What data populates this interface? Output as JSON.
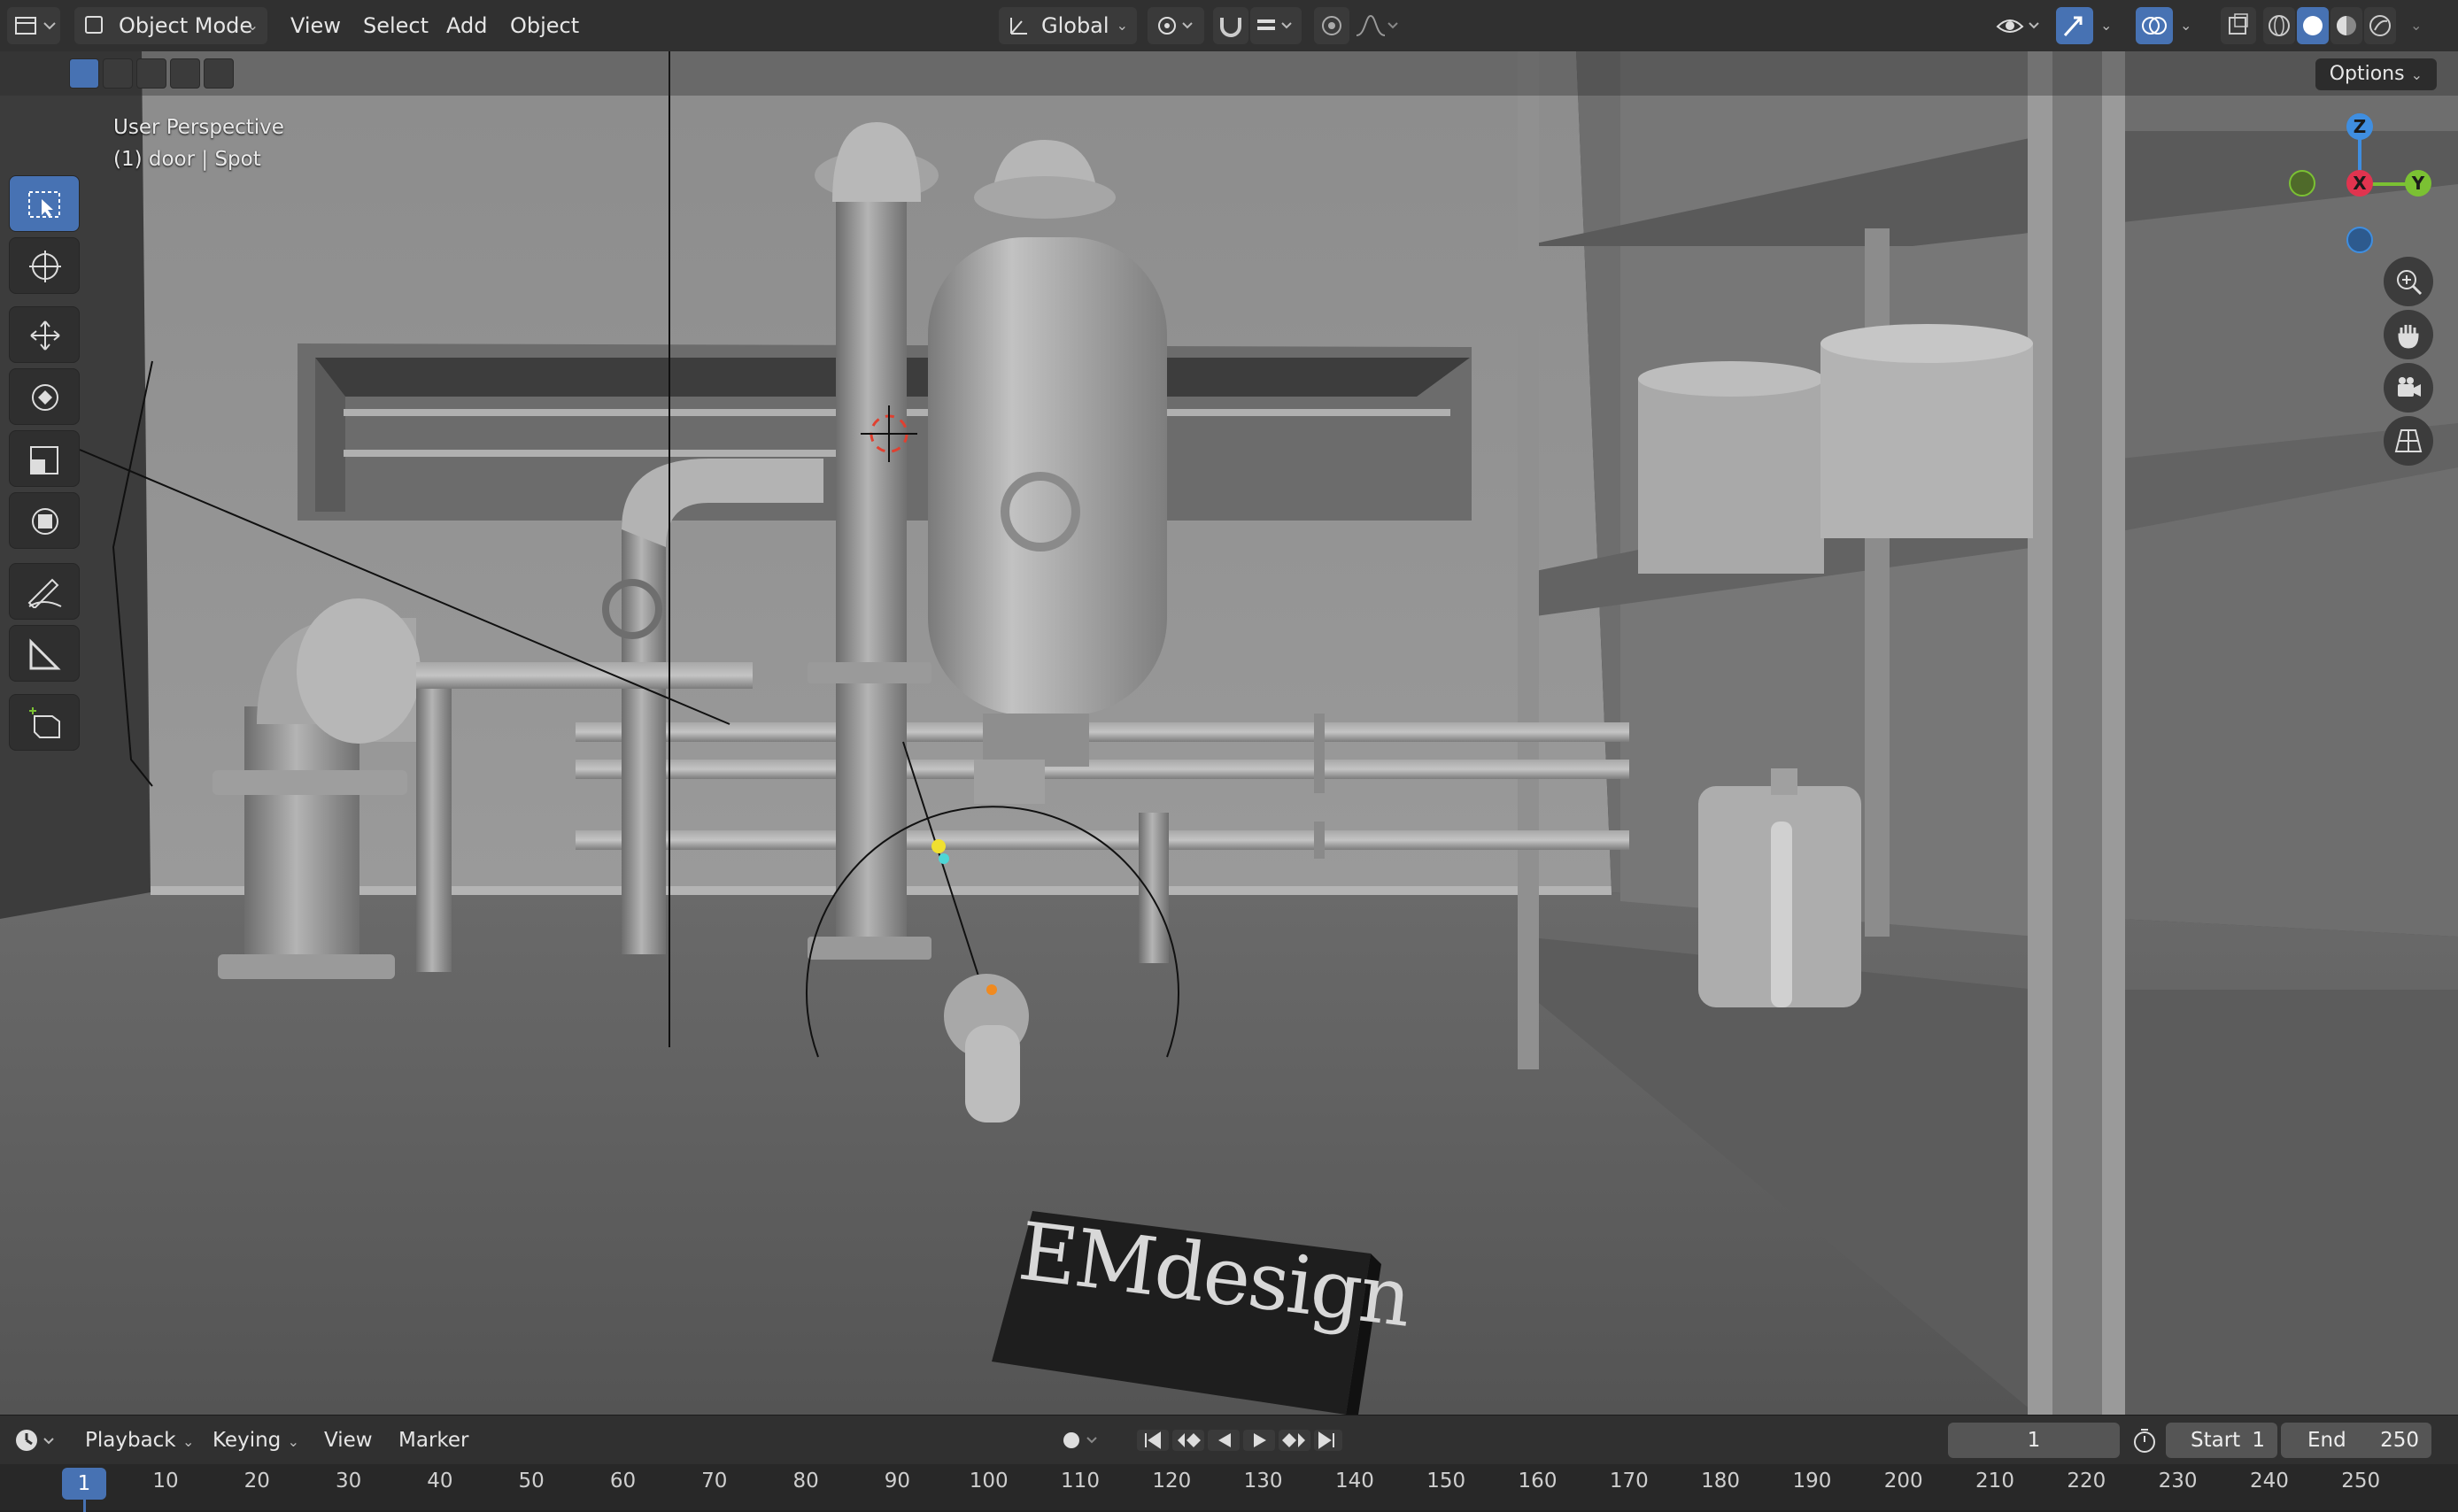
{
  "header": {
    "mode": "Object Mode",
    "menus": [
      "View",
      "Select",
      "Add",
      "Object"
    ],
    "transform_orientation": "Global",
    "options_label": "Options"
  },
  "viewport": {
    "perspective_label": "User Perspective",
    "object_label": "(1) door | Spot",
    "watermark": "EMdesign",
    "gizmo": {
      "z": "Z",
      "x": "X",
      "y": "Y"
    },
    "colors": {
      "background": "#4a4a4a",
      "wall": "#8a8a8a",
      "floor": "#5f5f5f",
      "accent": "#4772b3",
      "axis_x": "#e0344f",
      "axis_y": "#7bc133",
      "axis_z": "#3f8ee0"
    }
  },
  "tools": [
    "select-box-icon",
    "cursor-icon",
    "move-icon",
    "rotate-icon",
    "scale-icon",
    "transform-icon",
    "annotate-icon",
    "measure-icon",
    "add-cube-icon"
  ],
  "timeline": {
    "menus": [
      "Playback",
      "Keying",
      "View",
      "Marker"
    ],
    "current_frame": "1",
    "start_label": "Start",
    "start_value": "1",
    "end_label": "End",
    "end_value": "250",
    "ruler_ticks": [
      "10",
      "20",
      "30",
      "40",
      "50",
      "60",
      "70",
      "80",
      "90",
      "100",
      "110",
      "120",
      "130",
      "140",
      "150",
      "160",
      "170",
      "180",
      "190",
      "200",
      "210",
      "220",
      "230",
      "240",
      "250"
    ]
  }
}
